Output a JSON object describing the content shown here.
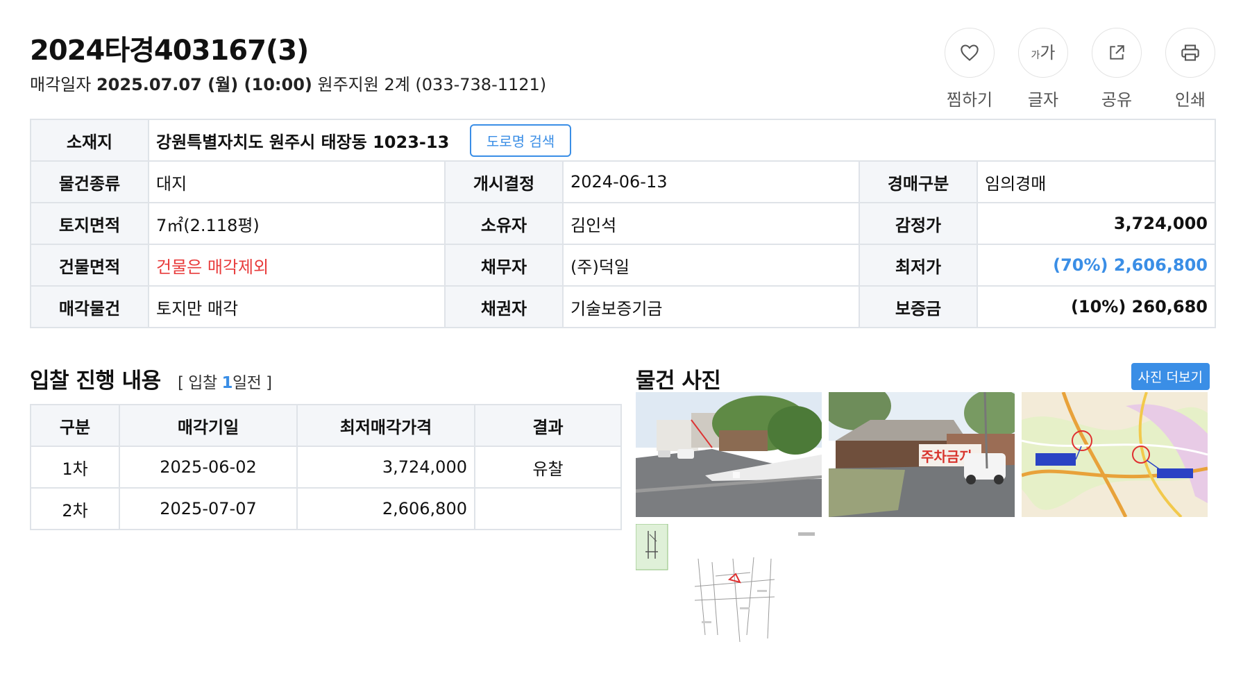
{
  "header": {
    "case_number": "2024타경403167(3)",
    "sale_date_label": "매각일자",
    "sale_date": "2025.07.07 (월) (10:00)",
    "court": "원주지원 2계 (033-738-1121)",
    "actions": [
      {
        "label": "찜하기",
        "icon": "heart-icon"
      },
      {
        "label": "글자",
        "icon": "font-size-icon"
      },
      {
        "label": "공유",
        "icon": "share-icon"
      },
      {
        "label": "인쇄",
        "icon": "print-icon"
      }
    ],
    "font_icon_small": "가",
    "font_icon_large": "가"
  },
  "info": {
    "location_label": "소재지",
    "location": "강원특별자치도 원주시 태장동 1023-13",
    "road_search_button": "도로명 검색",
    "rows": [
      {
        "l1": "물건종류",
        "v1": "대지",
        "l2": "개시결정",
        "v2": "2024-06-13",
        "l3": "경매구분",
        "v3": "임의경매"
      },
      {
        "l1": "토지면적",
        "v1": "7㎡(2.118평)",
        "l2": "소유자",
        "v2": "김인석",
        "l3": "감정가",
        "v3": "3,724,000"
      },
      {
        "l1": "건물면적",
        "v1": "건물은 매각제외",
        "l2": "채무자",
        "v2": "(주)덕일",
        "l3": "최저가",
        "v3": "(70%) 2,606,800"
      },
      {
        "l1": "매각물건",
        "v1": "토지만 매각",
        "l2": "채권자",
        "v2": "기술보증기금",
        "l3": "보증금",
        "v3": "(10%) 260,680"
      }
    ],
    "colors": {
      "highlight_red": "#e83b3b",
      "highlight_blue": "#3a8ee6"
    }
  },
  "bid": {
    "title": "입찰 진행 내용",
    "sub_prefix": "[ 입찰",
    "sub_num": "1",
    "sub_suffix": "일전 ]",
    "headers": [
      "구분",
      "매각기일",
      "최저매각가격",
      "결과"
    ],
    "rows": [
      {
        "round": "1차",
        "date": "2025-06-02",
        "price": "3,724,000",
        "result": "유찰"
      },
      {
        "round": "2차",
        "date": "2025-07-07",
        "price": "2,606,800",
        "result": ""
      }
    ]
  },
  "photos": {
    "title": "물건 사진",
    "more_button": "사진 더보기",
    "banner_text": "주차금지",
    "items": [
      "street-photo",
      "property-photo",
      "location-map",
      "cadastral-map"
    ]
  }
}
